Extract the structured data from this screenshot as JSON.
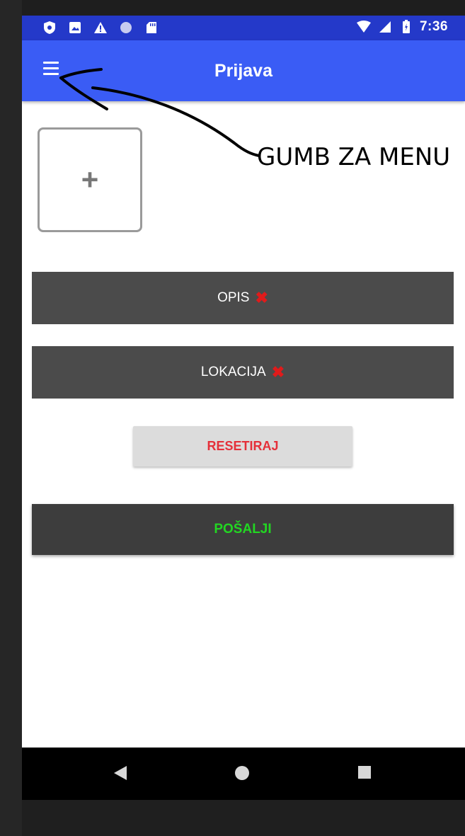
{
  "status_bar": {
    "time": "7:36",
    "left_icons": [
      "shield-icon",
      "image-icon",
      "warning-icon",
      "circle-icon",
      "sd-card-icon"
    ],
    "right_icons": [
      "wifi-icon",
      "signal-icon",
      "battery-icon"
    ],
    "color": "#2439c9"
  },
  "app_bar": {
    "title": "Prijava",
    "menu_icon": "hamburger-menu-icon",
    "color": "#3a5cf5"
  },
  "annotation": {
    "text": "GUMB ZA MENU"
  },
  "form": {
    "add_photo_symbol": "+",
    "description_label": "OPIS",
    "description_status_icon": "red-x-icon",
    "location_label": "LOKACIJA",
    "location_status_icon": "red-x-icon",
    "status_mark": "✖",
    "reset_label": "RESETIRAJ",
    "reset_color": "#e5303a",
    "send_label": "POŠALJI",
    "send_color": "#22d622"
  },
  "nav_bar": {
    "back_icon": "back-triangle-icon",
    "home_icon": "home-circle-icon",
    "recent_icon": "recents-square-icon"
  }
}
